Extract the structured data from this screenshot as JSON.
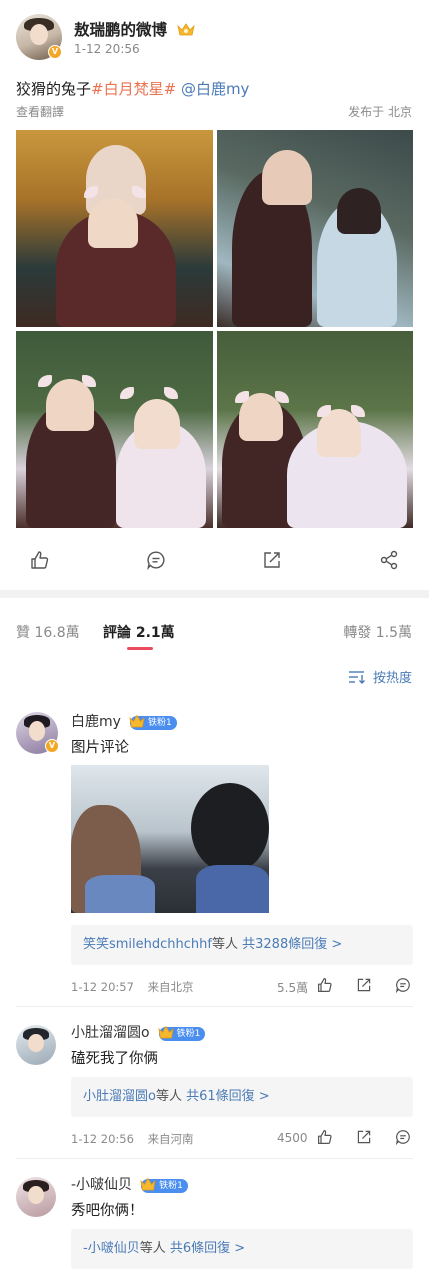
{
  "post": {
    "author": "敖瑞鹏的微博",
    "time": "1-12 20:56",
    "text_main": "狡猾的兔子",
    "hashtag": "#白月梵星#",
    "mention": "@白鹿my",
    "translate": "查看翻譯",
    "location": "发布于 北京",
    "avatar_badge": "V"
  },
  "actions": {
    "like_icon": "thumbs-up-icon",
    "comment_icon": "comment-icon",
    "repost_icon": "repost-icon",
    "share_icon": "share-icon"
  },
  "tabs": {
    "likes": "贊 16.8萬",
    "comments": "評論 2.1萬",
    "reposts": "轉發 1.5萬",
    "sort": "按热度"
  },
  "comments": [
    {
      "name": "白鹿my",
      "badge": "铁粉1",
      "text": "图片评论",
      "reply_names": "笑笑smilehdchhchhf",
      "reply_mid": "等人",
      "reply_count": "共3288條回復 >",
      "time": "1-12 20:57",
      "from": "来自北京",
      "likes": "5.5萬"
    },
    {
      "name": "小肚溜溜圆o",
      "badge": "铁粉1",
      "text": "磕死我了你俩",
      "reply_names": "小肚溜溜圆o",
      "reply_mid": "等人",
      "reply_count": "共61條回復 >",
      "time": "1-12 20:56",
      "from": "来自河南",
      "likes": "4500"
    },
    {
      "name": "-小啵仙贝",
      "badge": "铁粉1",
      "text": "秀吧你俩！",
      "reply_names": "-小啵仙贝",
      "reply_mid": "等人",
      "reply_count": "共6條回復 >"
    }
  ],
  "colors": {
    "link_blue": "#4a7bb7",
    "hashtag_orange": "#eb7350",
    "tab_underline": "#eb4b5c",
    "fan_badge": "#4a8ef0"
  }
}
